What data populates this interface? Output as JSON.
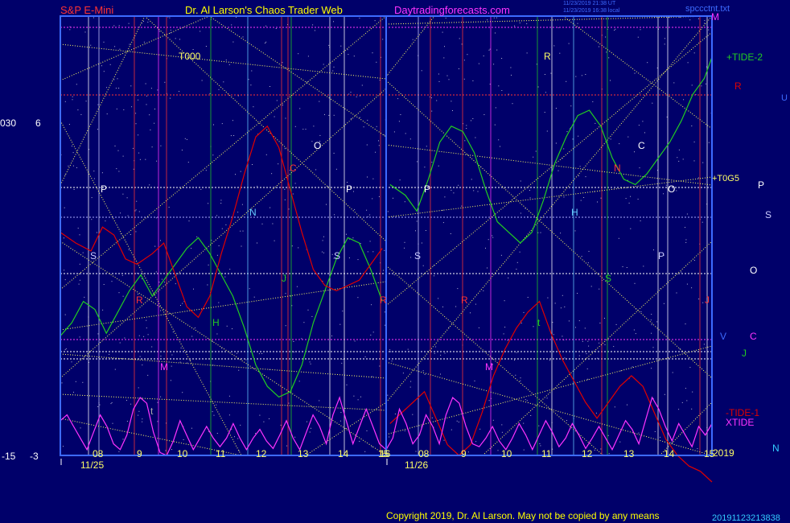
{
  "header": {
    "symbol": "S&P E-Mini",
    "author": "Dr. Al Larson's Chaos Trader Web",
    "site": "Daytradingforecasts.com",
    "stamp_line1": "11/23/2019 21:38 UT",
    "stamp_line2": "11/23/2019 16:38 local",
    "file": "spccctnt.txt",
    "copyright": "Copyright 2019, Dr. Al Larson. May not be copied by any means",
    "bottom_stamp": "20191123213838"
  },
  "colors": {
    "background": "#00006a",
    "tide1": "#e00000",
    "tide2": "#22cc22",
    "xtide": "#ff33ff",
    "gann": "#ffff66",
    "axis": "#3d6bff"
  },
  "chart_data": {
    "type": "line",
    "left_axis": {
      "tide2_top": "030",
      "tide1_top": "6",
      "tide2_bottom": "-15",
      "tide1_bottom": "-3"
    },
    "days": [
      {
        "date": "11/25",
        "hours": [
          "08",
          "9",
          "10",
          "11",
          "12",
          "13",
          "14",
          "15",
          "16"
        ]
      },
      {
        "date": "11/26",
        "hours": [
          "08",
          "9",
          "10",
          "11",
          "12",
          "13",
          "14",
          "15",
          "1"
        ]
      }
    ],
    "year_label": "2019",
    "series": [
      {
        "name": "+TIDE-2",
        "color": "#22cc22",
        "values": [
          [
            0,
            0.45
          ],
          [
            0.3,
            0.5
          ],
          [
            0.6,
            0.58
          ],
          [
            0.9,
            0.55
          ],
          [
            1.2,
            0.46
          ],
          [
            1.5,
            0.54
          ],
          [
            1.8,
            0.62
          ],
          [
            2.1,
            0.68
          ],
          [
            2.4,
            0.6
          ],
          [
            2.7,
            0.66
          ],
          [
            3.0,
            0.72
          ],
          [
            3.3,
            0.78
          ],
          [
            3.6,
            0.82
          ],
          [
            3.9,
            0.76
          ],
          [
            4.2,
            0.68
          ],
          [
            4.5,
            0.6
          ],
          [
            4.8,
            0.48
          ],
          [
            5.1,
            0.34
          ],
          [
            5.4,
            0.26
          ],
          [
            5.7,
            0.22
          ],
          [
            6.0,
            0.24
          ],
          [
            6.3,
            0.34
          ],
          [
            6.6,
            0.5
          ],
          [
            6.9,
            0.62
          ],
          [
            7.2,
            0.74
          ],
          [
            7.5,
            0.82
          ],
          [
            7.8,
            0.8
          ],
          [
            8.1,
            0.7
          ],
          [
            8.4,
            0.58
          ],
          [
            8.6,
            1.02
          ],
          [
            9.0,
            0.98
          ],
          [
            9.3,
            0.92
          ],
          [
            9.6,
            1.04
          ],
          [
            9.9,
            1.18
          ],
          [
            10.2,
            1.24
          ],
          [
            10.5,
            1.22
          ],
          [
            10.8,
            1.14
          ],
          [
            11.1,
            1.0
          ],
          [
            11.4,
            0.88
          ],
          [
            11.7,
            0.84
          ],
          [
            12.0,
            0.8
          ],
          [
            12.3,
            0.84
          ],
          [
            12.6,
            0.96
          ],
          [
            12.9,
            1.1
          ],
          [
            13.2,
            1.2
          ],
          [
            13.5,
            1.28
          ],
          [
            13.8,
            1.3
          ],
          [
            14.1,
            1.24
          ],
          [
            14.4,
            1.12
          ],
          [
            14.7,
            1.04
          ],
          [
            15.0,
            1.02
          ],
          [
            15.3,
            1.06
          ],
          [
            15.6,
            1.12
          ],
          [
            15.9,
            1.18
          ],
          [
            16.2,
            1.26
          ],
          [
            16.5,
            1.36
          ],
          [
            16.8,
            1.42
          ],
          [
            17.0,
            1.5
          ]
        ]
      },
      {
        "name": "-TIDE-1",
        "color": "#e00000",
        "values": [
          [
            0,
            0.84
          ],
          [
            0.4,
            0.8
          ],
          [
            0.8,
            0.77
          ],
          [
            1.1,
            0.86
          ],
          [
            1.4,
            0.83
          ],
          [
            1.7,
            0.74
          ],
          [
            2.0,
            0.72
          ],
          [
            2.4,
            0.76
          ],
          [
            2.7,
            0.8
          ],
          [
            3.0,
            0.68
          ],
          [
            3.3,
            0.56
          ],
          [
            3.6,
            0.52
          ],
          [
            3.9,
            0.6
          ],
          [
            4.2,
            0.76
          ],
          [
            4.5,
            0.9
          ],
          [
            4.8,
            1.06
          ],
          [
            5.1,
            1.2
          ],
          [
            5.4,
            1.24
          ],
          [
            5.7,
            1.16
          ],
          [
            6.0,
            1.0
          ],
          [
            6.3,
            0.84
          ],
          [
            6.6,
            0.7
          ],
          [
            6.9,
            0.64
          ],
          [
            7.2,
            0.62
          ],
          [
            7.5,
            0.64
          ],
          [
            7.8,
            0.66
          ],
          [
            8.1,
            0.72
          ],
          [
            8.4,
            0.78
          ],
          [
            8.6,
            0.12
          ],
          [
            8.9,
            0.16
          ],
          [
            9.2,
            0.2
          ],
          [
            9.5,
            0.24
          ],
          [
            9.8,
            0.14
          ],
          [
            10.1,
            0.04
          ],
          [
            10.4,
            0.0
          ],
          [
            10.7,
            0.04
          ],
          [
            11.0,
            0.16
          ],
          [
            11.3,
            0.3
          ],
          [
            11.6,
            0.4
          ],
          [
            11.9,
            0.48
          ],
          [
            12.2,
            0.54
          ],
          [
            12.5,
            0.58
          ],
          [
            12.8,
            0.46
          ],
          [
            13.1,
            0.36
          ],
          [
            13.4,
            0.28
          ],
          [
            13.7,
            0.2
          ],
          [
            14.0,
            0.14
          ],
          [
            14.3,
            0.2
          ],
          [
            14.6,
            0.26
          ],
          [
            14.9,
            0.3
          ],
          [
            15.2,
            0.26
          ],
          [
            15.5,
            0.16
          ],
          [
            15.8,
            0.06
          ],
          [
            16.1,
            0.0
          ],
          [
            16.4,
            -0.04
          ],
          [
            16.7,
            -0.06
          ],
          [
            17.0,
            -0.1
          ]
        ]
      }
    ],
    "xtide": {
      "name": "XTIDE",
      "color": "#ff33ff",
      "values": [
        0.6,
        0.7,
        0.5,
        0.3,
        0.1,
        0.4,
        0.7,
        0.5,
        0.2,
        0.1,
        0.35,
        0.8,
        1.0,
        0.9,
        0.4,
        0.05,
        0.0,
        0.25,
        0.6,
        0.35,
        0.1,
        0.3,
        0.5,
        0.3,
        0.15,
        0.3,
        0.55,
        0.3,
        0.1,
        0.3,
        0.45,
        0.25,
        0.12,
        0.35,
        0.6,
        0.3,
        0.1,
        0.4,
        0.7,
        0.5,
        0.2,
        0.7,
        1.0,
        0.6,
        0.2,
        0.5,
        0.8,
        0.5,
        0.2,
        0.1,
        0.3,
        0.8,
        0.55,
        0.2,
        0.35,
        0.7,
        0.5,
        0.2,
        0.7,
        1.0,
        0.9,
        0.5,
        0.2,
        0.15,
        0.3,
        0.5,
        0.25,
        0.1,
        0.3,
        0.55,
        0.35,
        0.1,
        0.35,
        0.6,
        0.4,
        0.15,
        0.3,
        0.55,
        0.35,
        0.12,
        0.3,
        0.5,
        0.3,
        0.1,
        0.35,
        0.6,
        0.45,
        0.2,
        0.6,
        1.0,
        0.8,
        0.5,
        0.25,
        0.55,
        0.35,
        0.15,
        0.5,
        0.35,
        0.55
      ]
    },
    "right_labels": {
      "tide2": "+TIDE-2",
      "tide1": "-TIDE-1",
      "xtide": "XTIDE",
      "t000": "T000",
      "m": "M",
      "r": "R",
      "u": "U",
      "p": "P",
      "s": "S",
      "o": "O",
      "v": "V",
      "c": "C",
      "j": "J",
      "n": "N",
      "fut": "+T0G5"
    },
    "planet_labels": [
      "P",
      "S",
      "R",
      "M",
      "t",
      "H",
      "N",
      "C",
      "O",
      "P",
      "S",
      "J",
      "R",
      "T000"
    ]
  }
}
